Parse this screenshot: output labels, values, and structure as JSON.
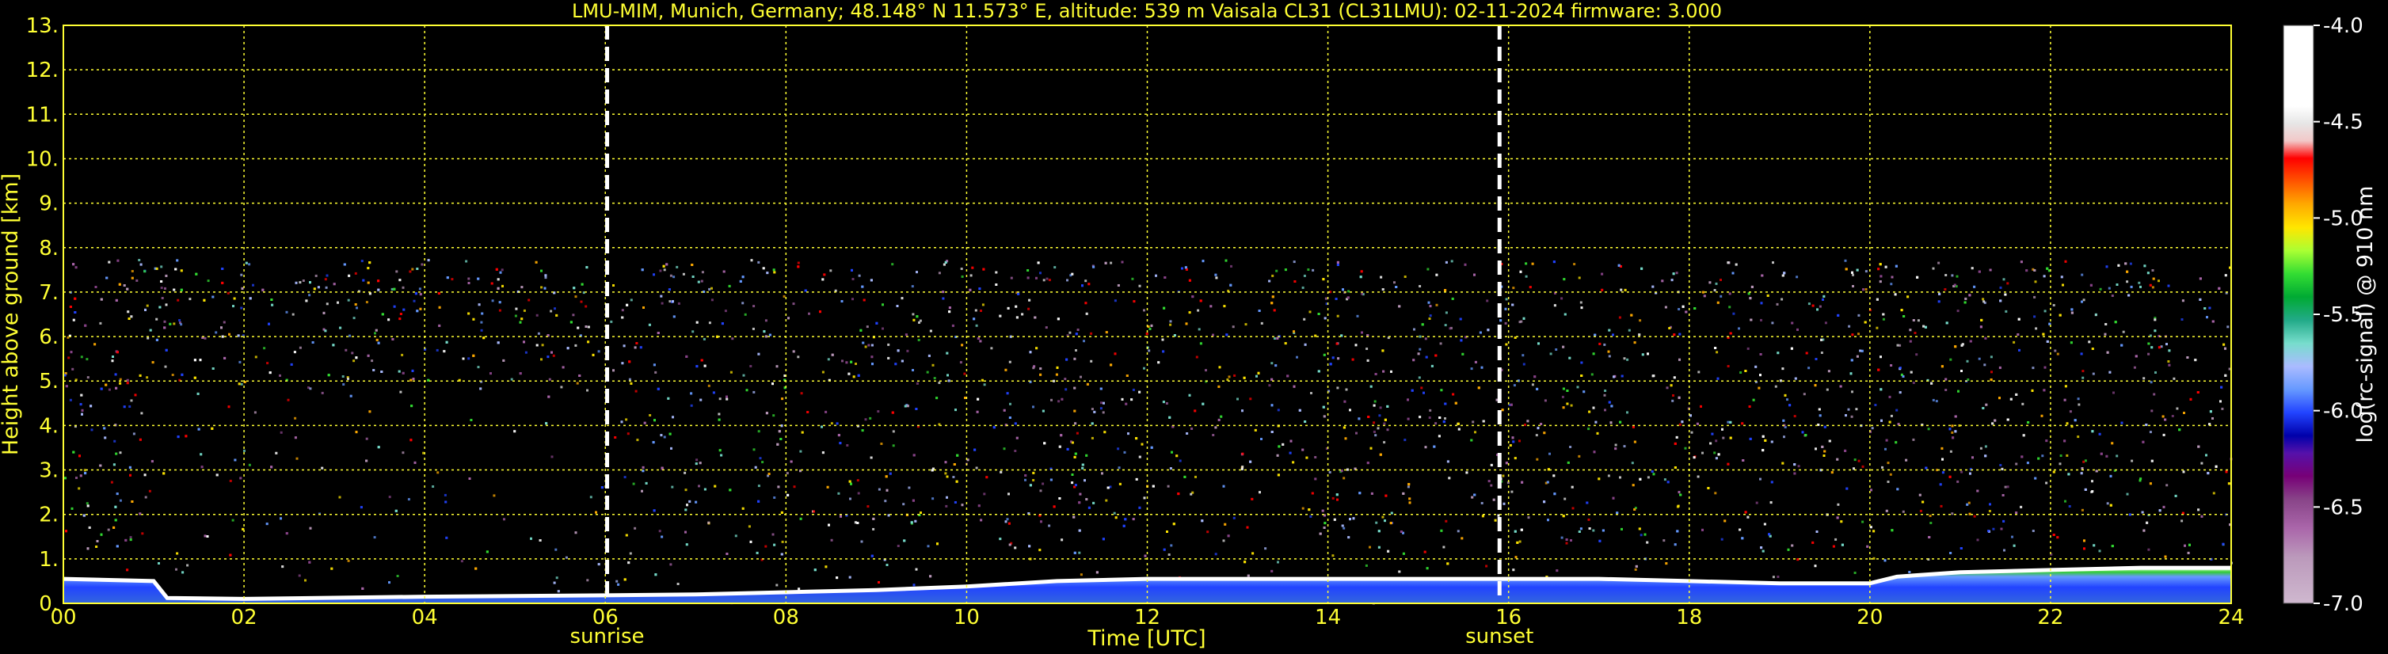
{
  "chart_data": {
    "type": "heatmap",
    "title": "LMU-MIM, Munich, Germany; 48.148° N 11.573° E, altitude: 539 m    Vaisala CL31 (CL31LMU): 02-11-2024    firmware: 3.000",
    "xlabel": "Time [UTC]",
    "ylabel": "Height above ground [km]",
    "xlim": [
      0,
      24
    ],
    "ylim": [
      0,
      13
    ],
    "x_ticks": [
      "00",
      "02",
      "04",
      "06",
      "08",
      "10",
      "12",
      "14",
      "16",
      "18",
      "20",
      "22",
      "24"
    ],
    "y_ticks": [
      "0.",
      "1.",
      "2.",
      "3.",
      "4.",
      "5.",
      "6.",
      "7.",
      "8.",
      "9.",
      "10.",
      "11.",
      "12.",
      "13."
    ],
    "grid": true,
    "markers": [
      {
        "label": "sunrise",
        "x": 6.02
      },
      {
        "label": "sunset",
        "x": 15.9
      }
    ],
    "colorbar": {
      "label": "log(rc-signal) @ 910 nm",
      "range": [
        -7.0,
        -4.0
      ],
      "ticks": [
        "-4.0",
        "-4.5",
        "-5.0",
        "-5.5",
        "-6.0",
        "-6.5",
        "-7.0"
      ]
    },
    "noise_top_km": 7.75,
    "boundary_layer_top_km": [
      [
        0.0,
        0.55
      ],
      [
        1.0,
        0.5
      ],
      [
        1.15,
        0.12
      ],
      [
        2,
        0.1
      ],
      [
        4,
        0.15
      ],
      [
        6,
        0.18
      ],
      [
        7,
        0.2
      ],
      [
        8,
        0.25
      ],
      [
        9,
        0.3
      ],
      [
        10,
        0.38
      ],
      [
        11,
        0.5
      ],
      [
        12,
        0.55
      ],
      [
        13,
        0.55
      ],
      [
        14,
        0.55
      ],
      [
        15,
        0.55
      ],
      [
        16,
        0.55
      ],
      [
        17,
        0.55
      ],
      [
        18,
        0.5
      ],
      [
        19,
        0.45
      ],
      [
        20,
        0.45
      ],
      [
        20.3,
        0.6
      ],
      [
        21,
        0.7
      ],
      [
        22,
        0.75
      ],
      [
        23,
        0.8
      ],
      [
        24,
        0.8
      ]
    ]
  }
}
